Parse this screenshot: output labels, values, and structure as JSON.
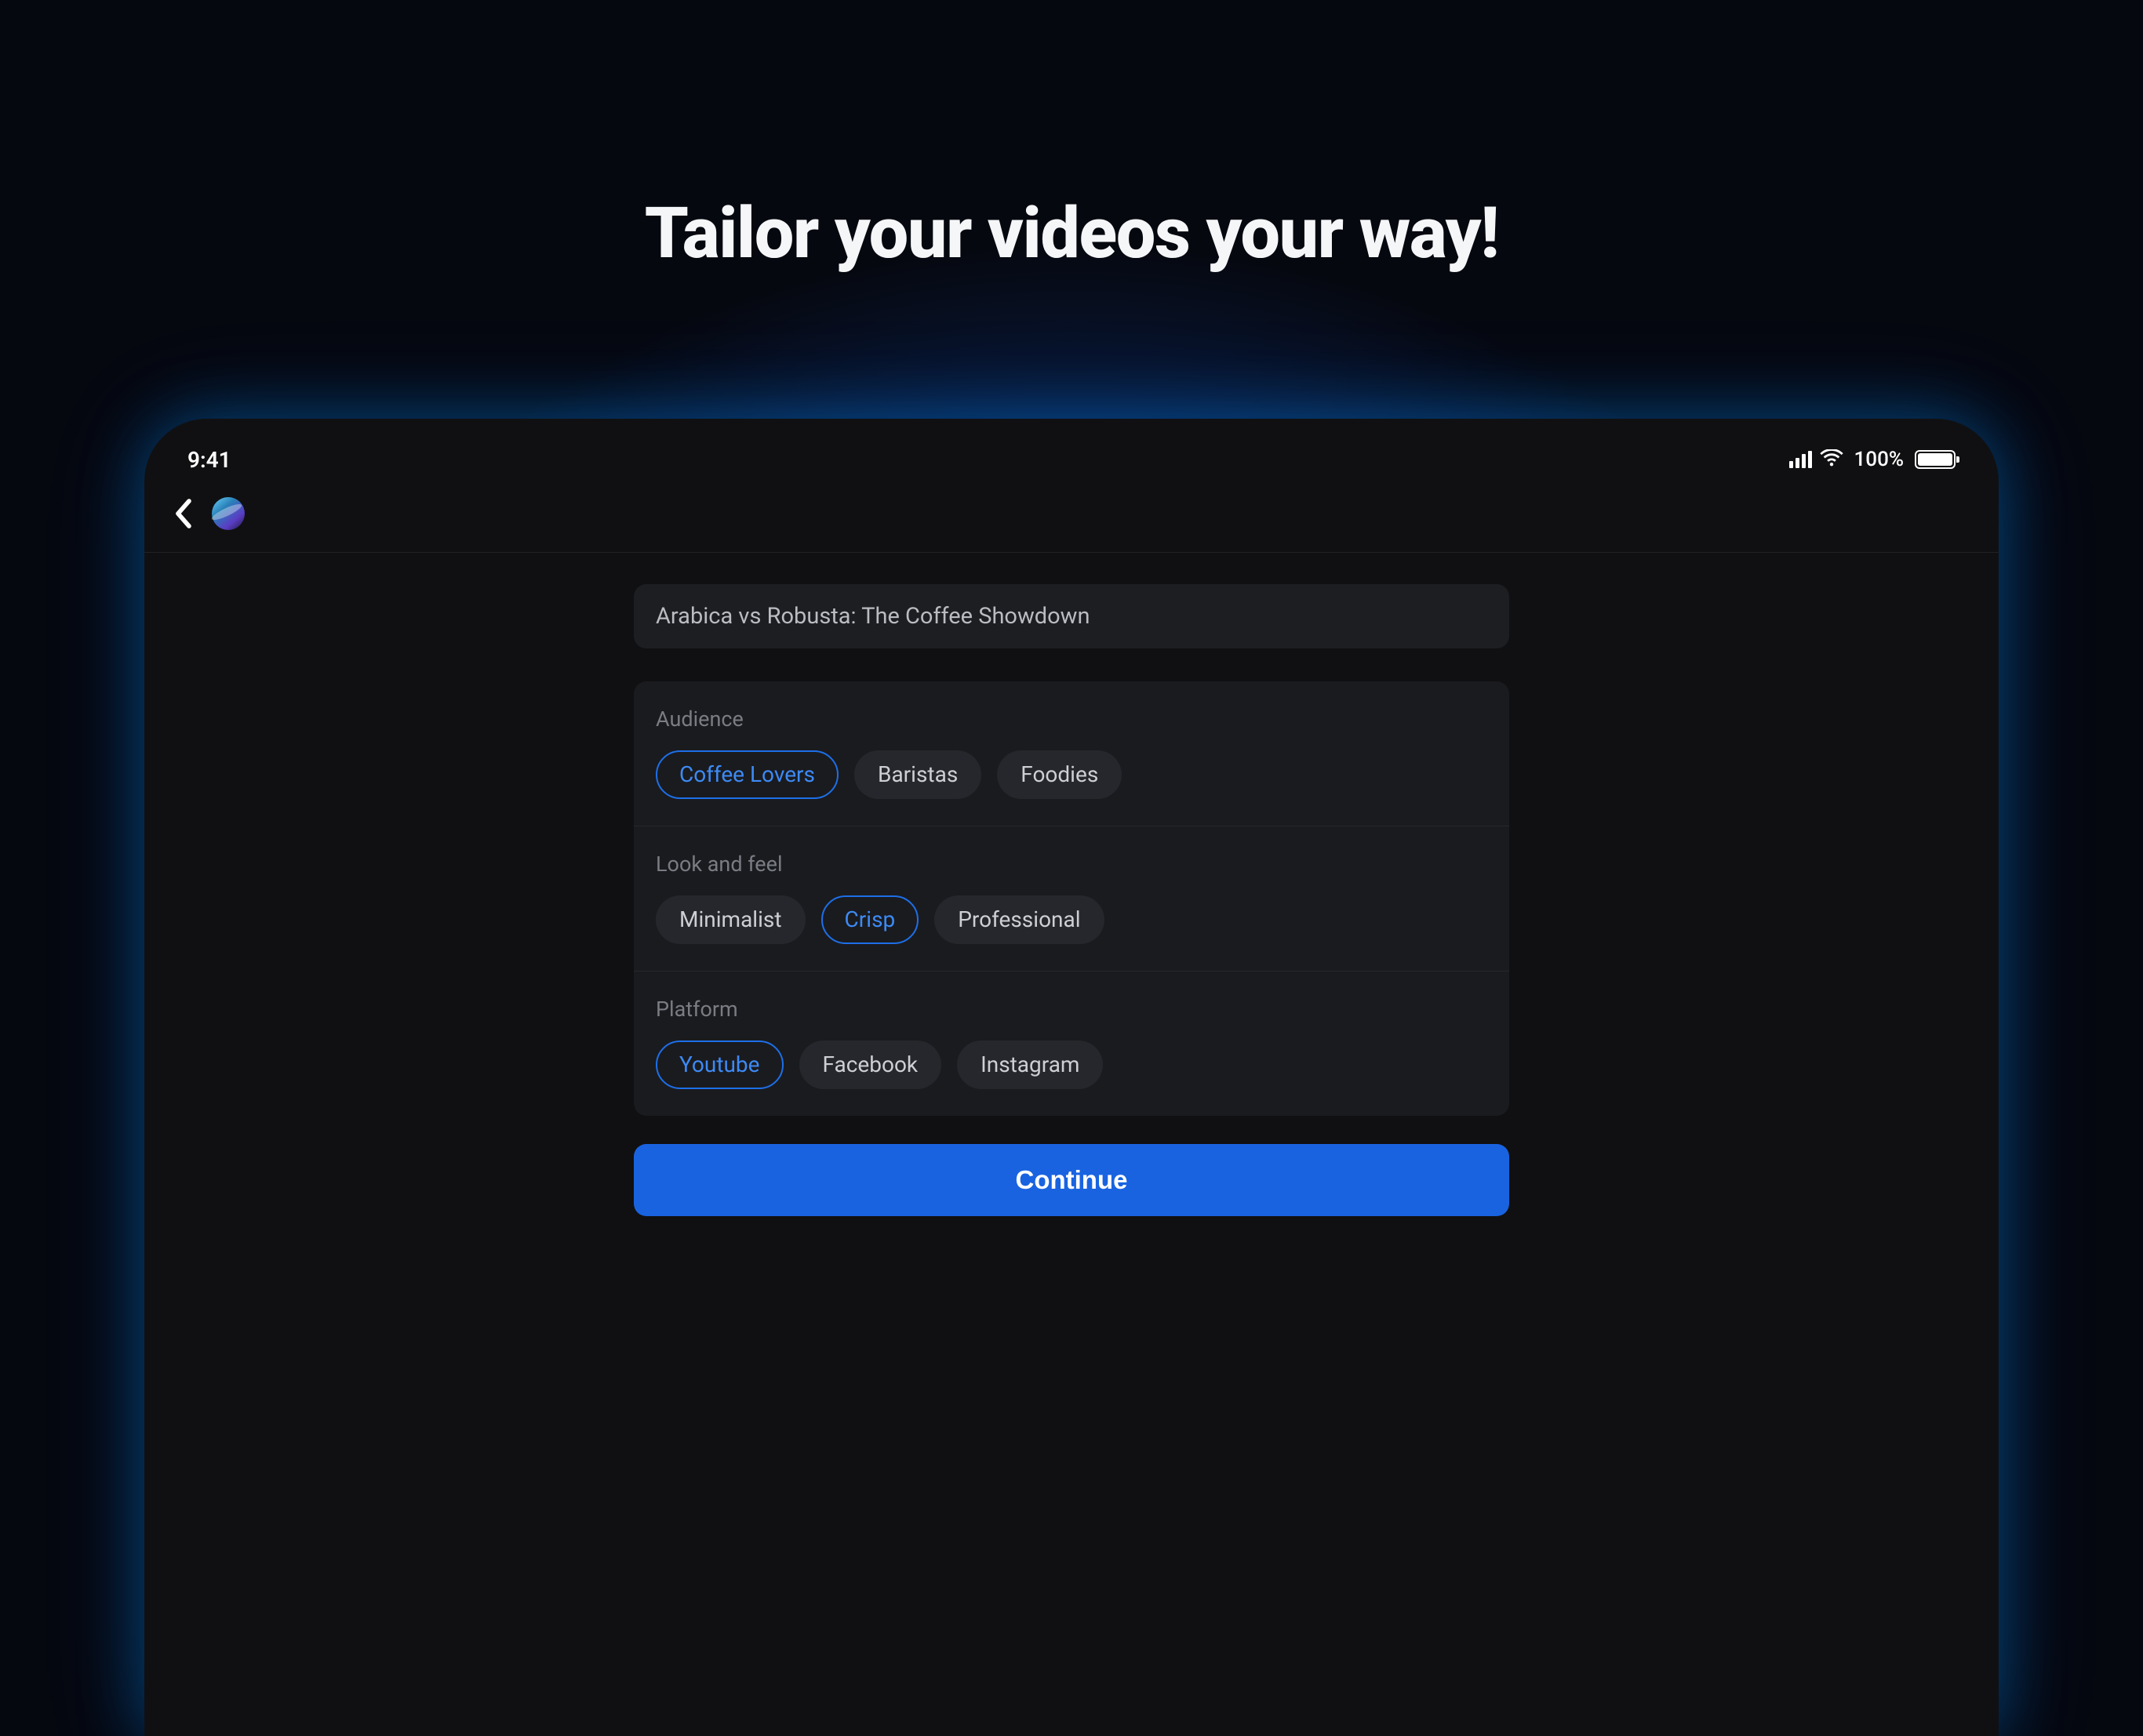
{
  "page_headline": "Tailor your videos your way!",
  "status": {
    "time": "9:41",
    "battery_text": "100%"
  },
  "form": {
    "title_value": "Arabica vs Robusta: The Coffee Showdown",
    "sections": {
      "audience": {
        "label": "Audience",
        "options": [
          {
            "label": "Coffee Lovers",
            "selected": true
          },
          {
            "label": "Baristas",
            "selected": false
          },
          {
            "label": "Foodies",
            "selected": false
          }
        ]
      },
      "look": {
        "label": "Look and feel",
        "options": [
          {
            "label": "Minimalist",
            "selected": false
          },
          {
            "label": "Crisp",
            "selected": true
          },
          {
            "label": "Professional",
            "selected": false
          }
        ]
      },
      "platform": {
        "label": "Platform",
        "options": [
          {
            "label": "Youtube",
            "selected": true
          },
          {
            "label": "Facebook",
            "selected": false
          },
          {
            "label": "Instagram",
            "selected": false
          }
        ]
      }
    },
    "continue_label": "Continue"
  }
}
